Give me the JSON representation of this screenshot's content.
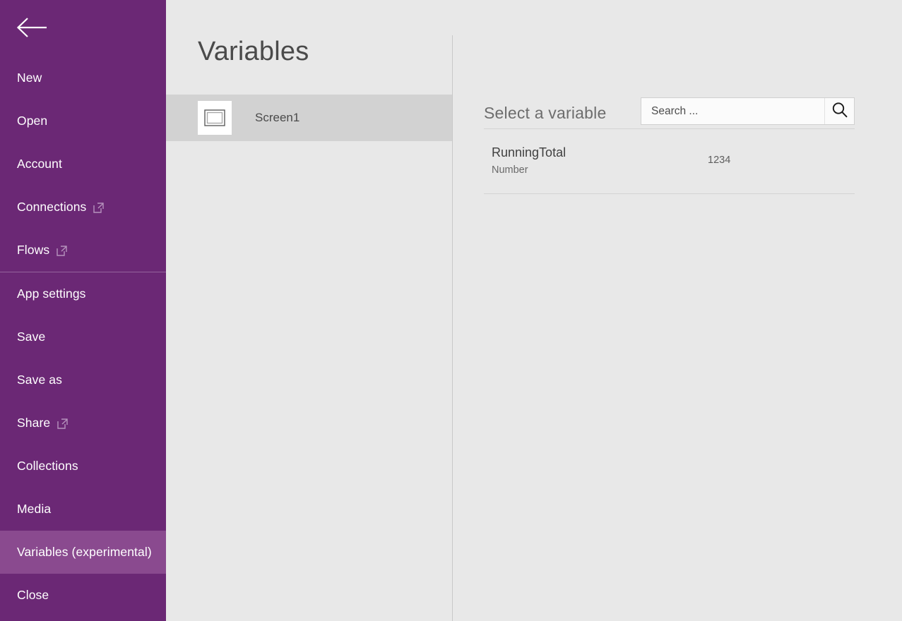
{
  "sidebar": {
    "background_color": "#6b2875",
    "selected_background_color": "#8a4a8f",
    "back_icon": "back-arrow-icon",
    "items": [
      {
        "label": "New",
        "external": false,
        "selected": false,
        "divider_after": false
      },
      {
        "label": "Open",
        "external": false,
        "selected": false,
        "divider_after": false
      },
      {
        "label": "Account",
        "external": false,
        "selected": false,
        "divider_after": false
      },
      {
        "label": "Connections",
        "external": true,
        "selected": false,
        "divider_after": false
      },
      {
        "label": "Flows",
        "external": true,
        "selected": false,
        "divider_after": true
      },
      {
        "label": "App settings",
        "external": false,
        "selected": false,
        "divider_after": false
      },
      {
        "label": "Save",
        "external": false,
        "selected": false,
        "divider_after": false
      },
      {
        "label": "Save as",
        "external": false,
        "selected": false,
        "divider_after": false
      },
      {
        "label": "Share",
        "external": true,
        "selected": false,
        "divider_after": false
      },
      {
        "label": "Collections",
        "external": false,
        "selected": false,
        "divider_after": false
      },
      {
        "label": "Media",
        "external": false,
        "selected": false,
        "divider_after": false
      },
      {
        "label": "Variables (experimental)",
        "external": false,
        "selected": true,
        "divider_after": false
      },
      {
        "label": "Close",
        "external": false,
        "selected": false,
        "divider_after": false
      }
    ],
    "external_link_icon": "external-link-icon"
  },
  "mid_panel": {
    "title": "Variables",
    "screens": [
      {
        "name": "Screen1",
        "icon": "screen-thumbnail-icon",
        "selected": true
      }
    ]
  },
  "right_panel": {
    "select_label": "Select a variable",
    "search": {
      "placeholder": "Search ...",
      "value": "",
      "icon": "search-icon"
    },
    "variables": [
      {
        "name": "RunningTotal",
        "type": "Number",
        "value": "1234"
      }
    ]
  }
}
